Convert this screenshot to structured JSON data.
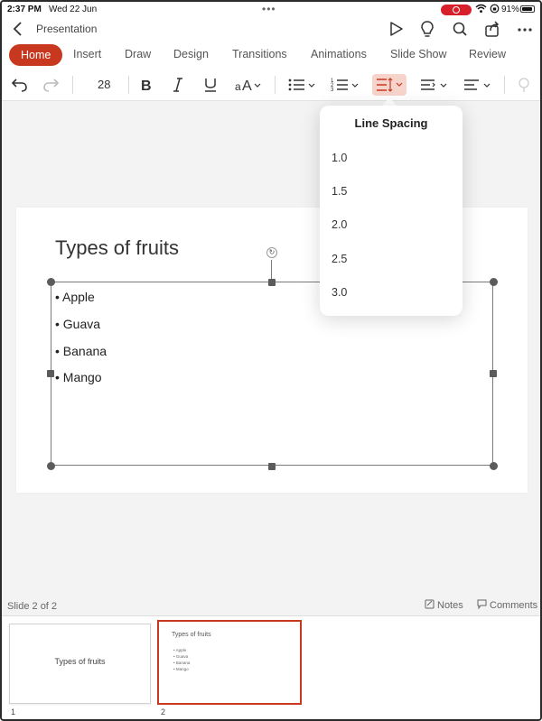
{
  "status_bar": {
    "time": "2:37 PM",
    "date": "Wed 22 Jun",
    "battery": "91%"
  },
  "title_bar": {
    "document_title": "Presentation"
  },
  "tabs": [
    {
      "label": "Home",
      "active": true
    },
    {
      "label": "Insert"
    },
    {
      "label": "Draw"
    },
    {
      "label": "Design"
    },
    {
      "label": "Transitions"
    },
    {
      "label": "Animations"
    },
    {
      "label": "Slide Show"
    },
    {
      "label": "Review"
    }
  ],
  "toolbar": {
    "font_size": "28"
  },
  "line_spacing_menu": {
    "title": "Line Spacing",
    "options": [
      "1.0",
      "1.5",
      "2.0",
      "2.5",
      "3.0"
    ]
  },
  "slide": {
    "title": "Types of fruits",
    "bullets": [
      "• Apple",
      "• Guava",
      "• Banana",
      "• Mango"
    ]
  },
  "footer": {
    "slide_status": "Slide 2 of 2",
    "notes_label": "Notes",
    "comments_label": "Comments"
  },
  "thumbnails": [
    {
      "number": "1",
      "title": "Types of fruits"
    },
    {
      "number": "2",
      "title": "Types of fruits",
      "items": [
        "• Apple",
        "• Guava",
        "• Banana",
        "• Mango"
      ]
    }
  ],
  "colors": {
    "accent": "#c8381f",
    "active_tool_bg": "#f6d3cb"
  }
}
